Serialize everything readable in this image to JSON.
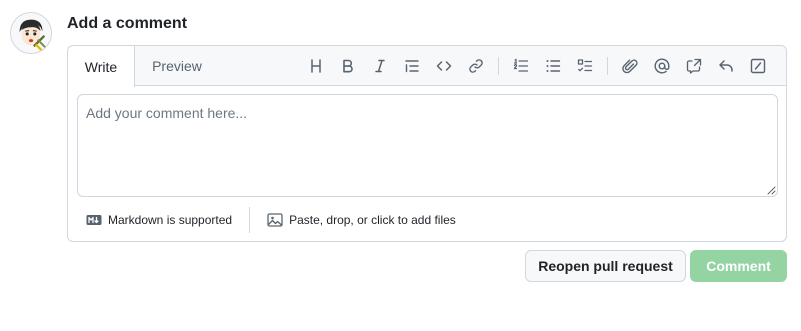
{
  "avatar": {
    "alt": "user avatar"
  },
  "heading": "Add a comment",
  "tabs": [
    {
      "label": "Write",
      "active": true
    },
    {
      "label": "Preview",
      "active": false
    }
  ],
  "toolbar": [
    {
      "icon": "heading-icon",
      "label": "Heading"
    },
    {
      "icon": "bold-icon",
      "label": "Bold"
    },
    {
      "icon": "italic-icon",
      "label": "Italic"
    },
    {
      "icon": "quote-icon",
      "label": "Quote"
    },
    {
      "icon": "code-icon",
      "label": "Code"
    },
    {
      "icon": "link-icon",
      "label": "Link"
    },
    {
      "icon": "numbered-list-icon",
      "label": "Numbered list"
    },
    {
      "icon": "unordered-list-icon",
      "label": "Unordered list"
    },
    {
      "icon": "task-list-icon",
      "label": "Task list"
    },
    {
      "icon": "paperclip-icon",
      "label": "Attach files"
    },
    {
      "icon": "mention-icon",
      "label": "Mention"
    },
    {
      "icon": "cross-reference-icon",
      "label": "Reference"
    },
    {
      "icon": "reply-icon",
      "label": "Saved replies"
    },
    {
      "icon": "slash-commands-icon",
      "label": "Slash commands"
    }
  ],
  "textarea": {
    "placeholder": "Add your comment here...",
    "value": ""
  },
  "footer": {
    "markdown_label": "Markdown is supported",
    "attach_label": "Paste, drop, or click to add files"
  },
  "buttons": {
    "reopen_label": "Reopen pull request",
    "comment_label": "Comment"
  },
  "colors": {
    "border": "#d0d7de",
    "header_bg": "#f6f8fa",
    "text": "#1f2328",
    "muted": "#59636e",
    "comment_disabled_bg": "#94d3a2"
  }
}
